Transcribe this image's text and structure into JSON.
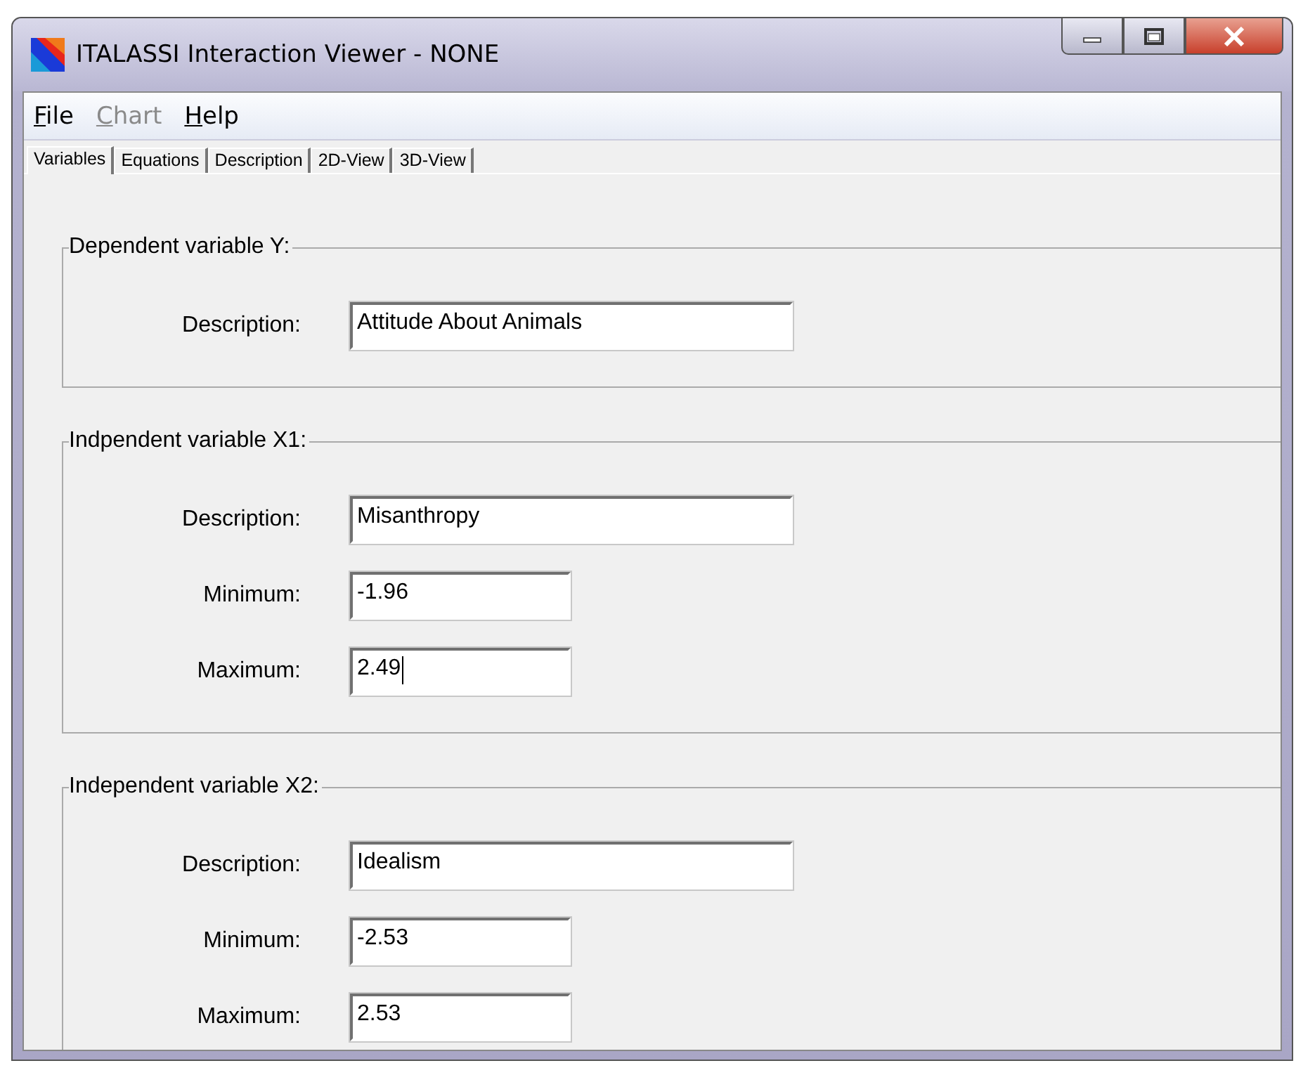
{
  "window": {
    "title": "ITALASSI Interaction Viewer - NONE"
  },
  "menu": [
    {
      "label": "File",
      "disabled": false
    },
    {
      "label": "Chart",
      "disabled": true
    },
    {
      "label": "Help",
      "disabled": false
    }
  ],
  "tabs": [
    {
      "label": "Variables",
      "selected": true
    },
    {
      "label": "Equations",
      "selected": false
    },
    {
      "label": "Description",
      "selected": false
    },
    {
      "label": "2D-View",
      "selected": false
    },
    {
      "label": "3D-View",
      "selected": false
    }
  ],
  "groups": [
    {
      "title": "Dependent variable Y:",
      "fields": [
        {
          "kind": "wide",
          "label": "Description:",
          "value": "Attitude About Animals",
          "focused": false
        }
      ]
    },
    {
      "title": "Indpendent variable X1:",
      "fields": [
        {
          "kind": "wide",
          "label": "Description:",
          "value": "Misanthropy",
          "focused": false
        },
        {
          "kind": "narrow",
          "label": "Minimum:",
          "value": "-1.96",
          "focused": false
        },
        {
          "kind": "narrow",
          "label": "Maximum:",
          "value": "2.49",
          "focused": true
        }
      ]
    },
    {
      "title": "Independent variable X2:",
      "fields": [
        {
          "kind": "wide",
          "label": "Description:",
          "value": "Idealism",
          "focused": false
        },
        {
          "kind": "narrow",
          "label": "Minimum:",
          "value": "-2.53",
          "focused": false
        },
        {
          "kind": "narrow",
          "label": "Maximum:",
          "value": "2.53",
          "focused": false
        }
      ]
    }
  ]
}
